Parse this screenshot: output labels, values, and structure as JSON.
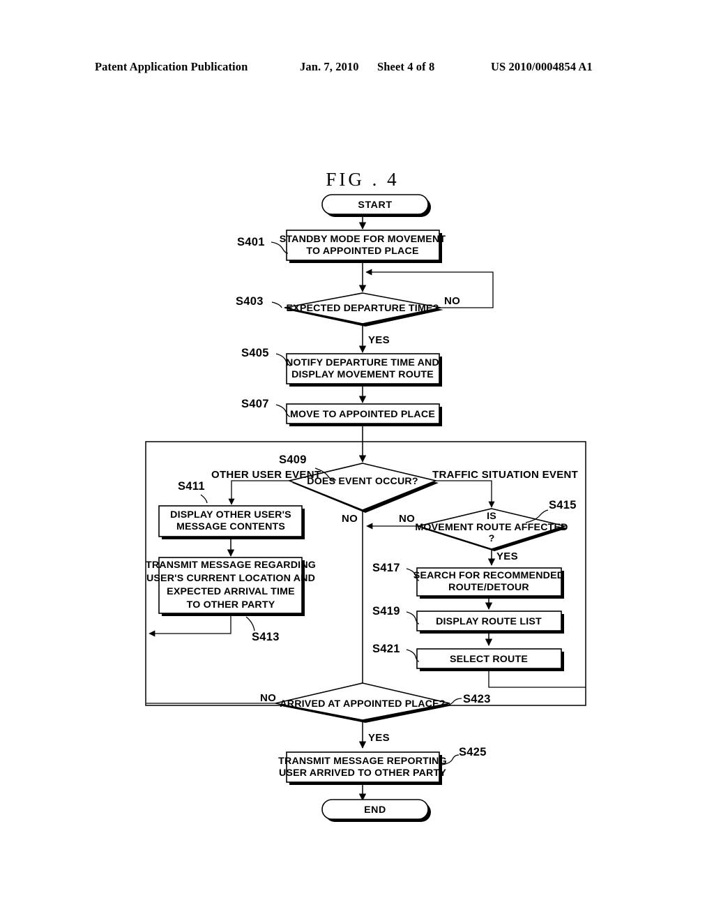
{
  "header": {
    "publication": "Patent Application Publication",
    "date": "Jan. 7, 2010",
    "sheet": "Sheet 4 of 8",
    "doc_number": "US 2010/0004854 A1"
  },
  "figure": {
    "title": "FIG . 4"
  },
  "nodes": {
    "start": {
      "label": "START",
      "ref": ""
    },
    "s401": {
      "ref": "S401",
      "lines": [
        "STANDBY MODE FOR MOVEMENT",
        "TO APPOINTED PLACE"
      ]
    },
    "s403": {
      "ref": "S403",
      "lines": [
        "EXPECTED DEPARTURE TIME?"
      ],
      "branch_no": "NO",
      "branch_yes": "YES"
    },
    "s405": {
      "ref": "S405",
      "lines": [
        "NOTIFY DEPARTURE TIME AND",
        "DISPLAY MOVEMENT ROUTE"
      ]
    },
    "s407": {
      "ref": "S407",
      "lines": [
        "MOVE TO APPOINTED PLACE"
      ]
    },
    "s409": {
      "ref": "S409",
      "lines": [
        "DOES EVENT OCCUR?"
      ],
      "branch_left": "OTHER USER EVENT",
      "branch_right": "TRAFFIC SITUATION EVENT",
      "branch_down": "NO"
    },
    "s411": {
      "ref": "S411",
      "lines": [
        "DISPLAY OTHER USER'S",
        "MESSAGE CONTENTS"
      ]
    },
    "s413": {
      "ref": "S413",
      "lines": [
        "TRANSMIT MESSAGE REGARDING",
        "USER'S CURRENT LOCATION  AND",
        "EXPECTED ARRIVAL TIME",
        "TO OTHER PARTY"
      ]
    },
    "s415": {
      "ref": "S415",
      "lines": [
        "IS",
        "MOVEMENT ROUTE AFFECTED",
        "?"
      ],
      "branch_no": "NO",
      "branch_yes": "YES"
    },
    "s417": {
      "ref": "S417",
      "lines": [
        "SEARCH FOR RECOMMENDED",
        "ROUTE/DETOUR"
      ]
    },
    "s419": {
      "ref": "S419",
      "lines": [
        "DISPLAY ROUTE LIST"
      ]
    },
    "s421": {
      "ref": "S421",
      "lines": [
        "SELECT ROUTE"
      ]
    },
    "s423": {
      "ref": "S423",
      "lines": [
        "ARRIVED AT APPOINTED PLACE?"
      ],
      "branch_no": "NO",
      "branch_yes": "YES"
    },
    "s425": {
      "ref": "S425",
      "lines": [
        "TRANSMIT MESSAGE REPORTING",
        "USER ARRIVED TO OTHER  PARTY"
      ]
    },
    "end": {
      "label": "END",
      "ref": ""
    }
  },
  "colors": {
    "ink": "#000000",
    "paper": "#ffffff"
  }
}
